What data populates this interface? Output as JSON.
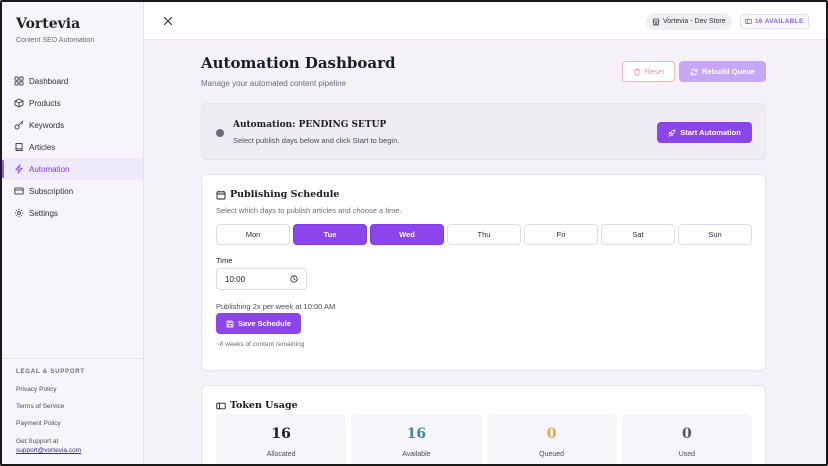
{
  "sidebar": {
    "brand": "Vortevia",
    "tagline": "Content SEO Automation",
    "items": [
      {
        "label": "Dashboard",
        "icon": "grid-icon"
      },
      {
        "label": "Products",
        "icon": "box-icon"
      },
      {
        "label": "Keywords",
        "icon": "key-icon"
      },
      {
        "label": "Articles",
        "icon": "book-icon"
      },
      {
        "label": "Automation",
        "icon": "bolt-icon",
        "active": true
      },
      {
        "label": "Subscription",
        "icon": "card-icon"
      },
      {
        "label": "Settings",
        "icon": "gear-icon"
      }
    ],
    "legal": {
      "title": "LEGAL & SUPPORT",
      "privacy": "Privacy Policy",
      "terms": "Terms of Service",
      "payment": "Payment Policy",
      "support_label": "Get Support at",
      "support_email": "support@vortevia.com"
    }
  },
  "topbar": {
    "store": "Vortevia - Dev Store",
    "available": "16 AVAILABLE"
  },
  "main": {
    "title": "Automation Dashboard",
    "subtitle": "Manage your automated content pipeline",
    "reset_label": "Reset",
    "rebuild_label": "Rebuild Queue"
  },
  "status": {
    "title": "Automation: PENDING SETUP",
    "subtitle": "Select publish days below and click Start to begin.",
    "start_label": "Start Automation"
  },
  "schedule": {
    "title": "Publishing Schedule",
    "subtitle": "Select which days to publish articles and choose a time.",
    "days": [
      {
        "label": "Mon",
        "selected": false
      },
      {
        "label": "Tue",
        "selected": true
      },
      {
        "label": "Wed",
        "selected": true
      },
      {
        "label": "Thu",
        "selected": false
      },
      {
        "label": "Fri",
        "selected": false
      },
      {
        "label": "Sat",
        "selected": false
      },
      {
        "label": "Sun",
        "selected": false
      }
    ],
    "time_label": "Time",
    "time_value": "10:00",
    "frequency": "Publishing 2x per week at 10:00 AM",
    "save_label": "Save Schedule",
    "remaining": "~8 weeks of content remaining"
  },
  "tokens": {
    "title": "Token Usage",
    "stats": [
      {
        "value": "16",
        "label": "Allocated",
        "color": "#1b1b24"
      },
      {
        "value": "16",
        "label": "Available",
        "color": "#3f8a9c"
      },
      {
        "value": "0",
        "label": "Queued",
        "color": "#f0a23a"
      },
      {
        "value": "0",
        "label": "Used",
        "color": "#555560"
      }
    ]
  }
}
